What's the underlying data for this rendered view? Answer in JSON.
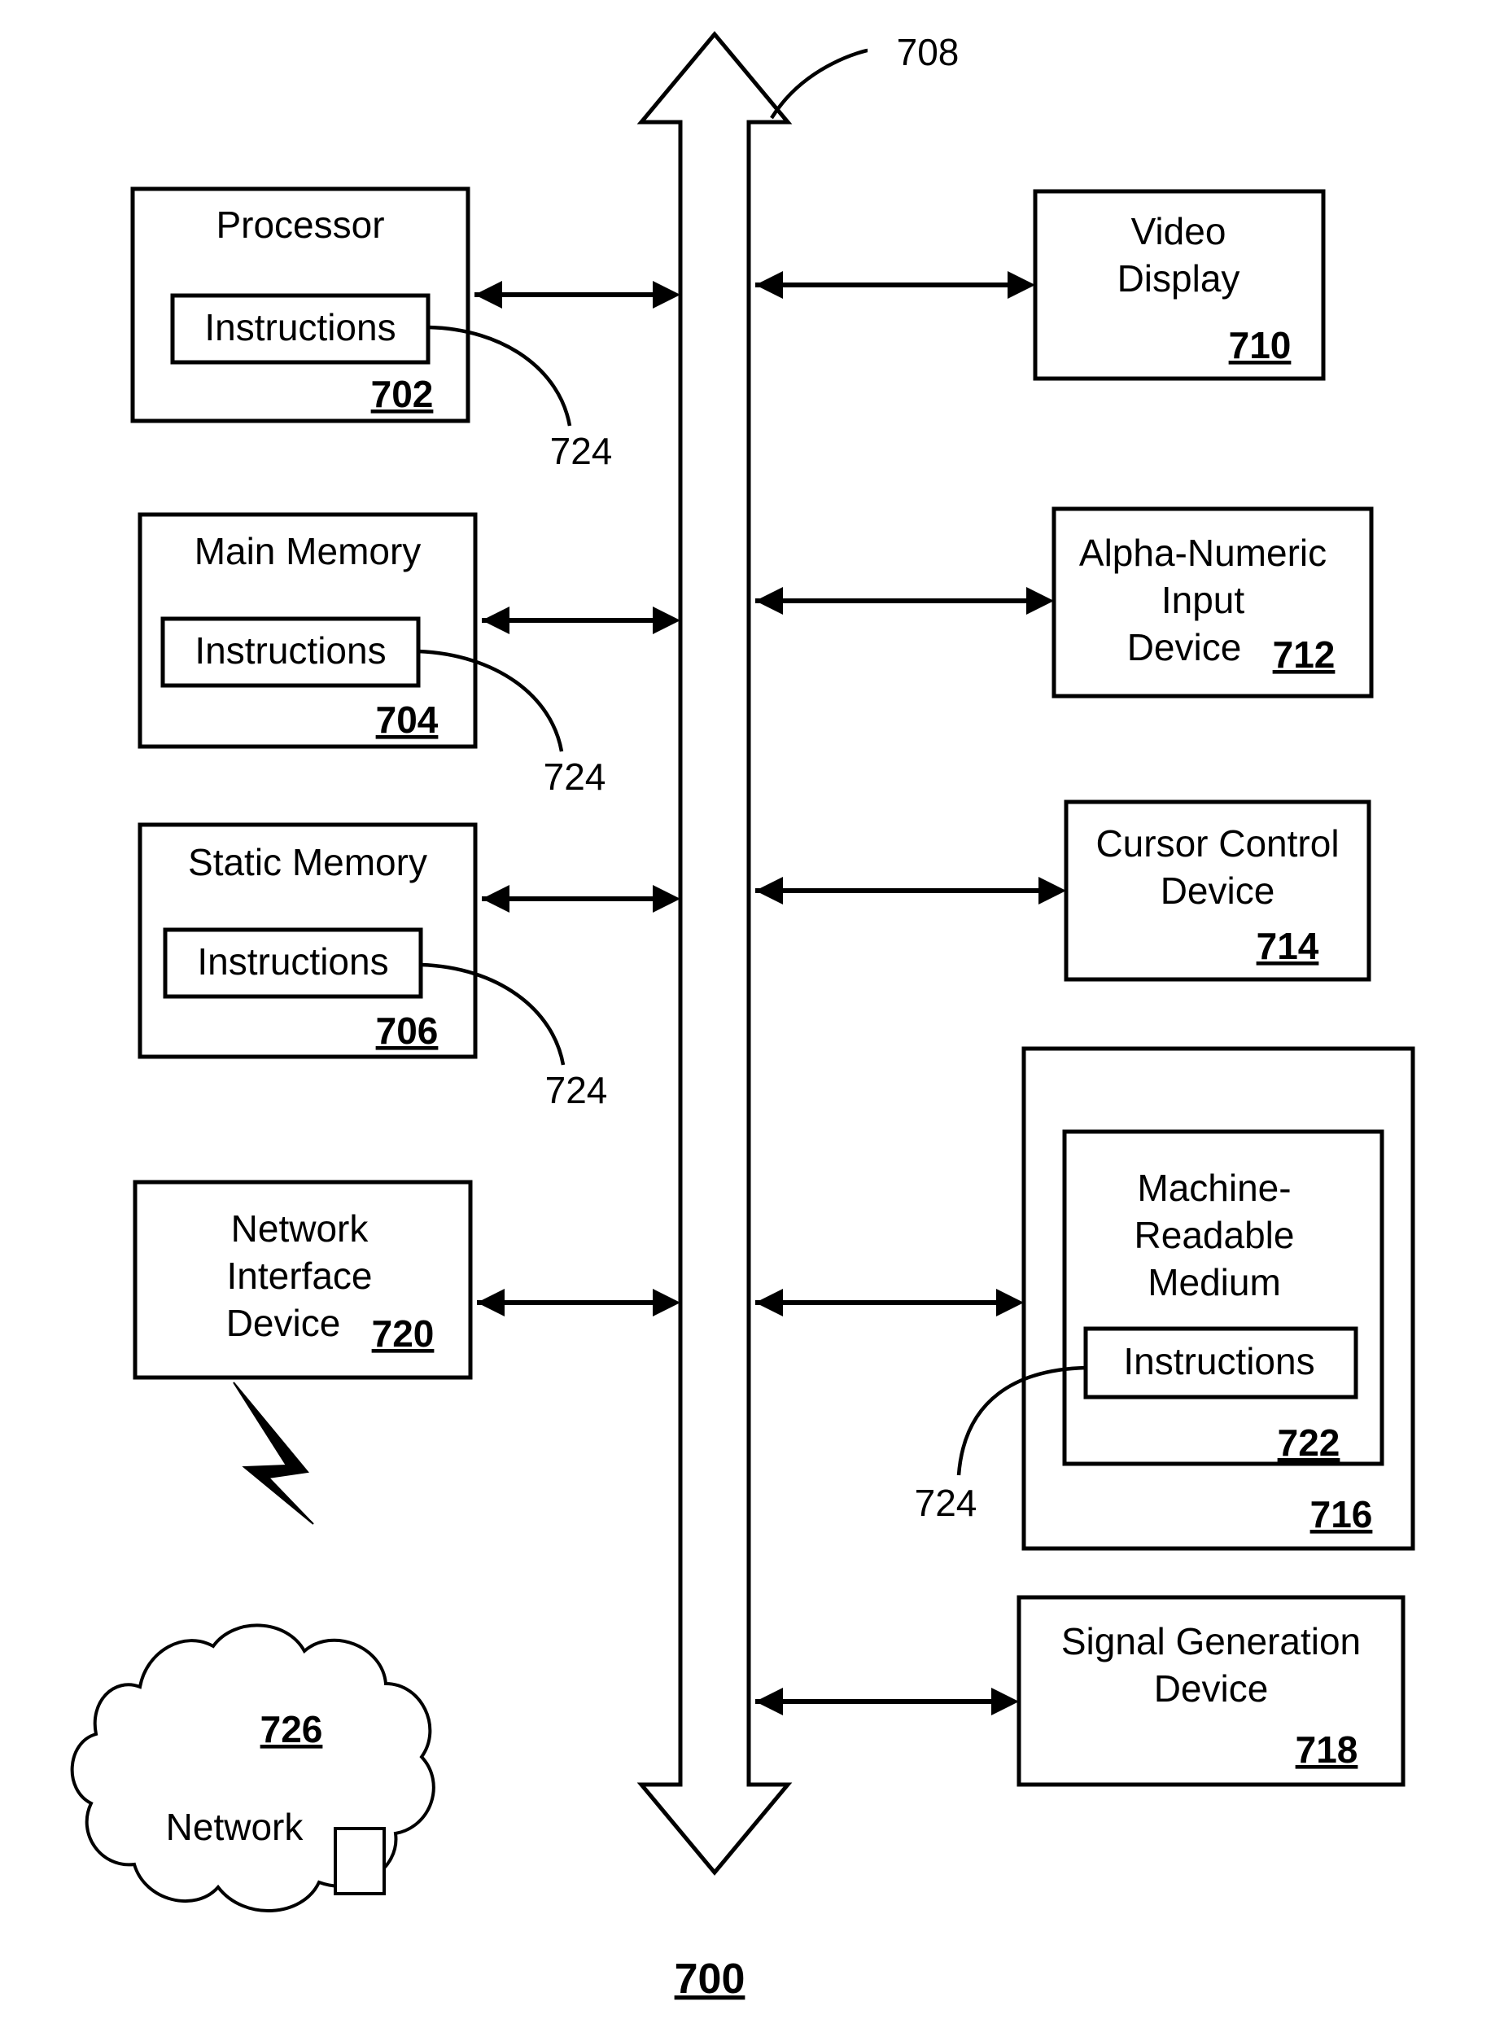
{
  "figure": {
    "number": "700",
    "bus_label": "708",
    "title_ref": "700"
  },
  "left_column": [
    {
      "name": "processor",
      "label": "Processor",
      "ref": "702",
      "inner_label": "Instructions",
      "leader_ref": "724"
    },
    {
      "name": "main-memory",
      "label": "Main Memory",
      "ref": "704",
      "inner_label": "Instructions",
      "leader_ref": "724"
    },
    {
      "name": "static-memory",
      "label": "Static Memory",
      "ref": "706",
      "inner_label": "Instructions",
      "leader_ref": "724"
    },
    {
      "name": "network-interface-device",
      "label_line1": "Network",
      "label_line2": "Interface",
      "label_line3": "Device",
      "ref": "720"
    }
  ],
  "right_column": [
    {
      "name": "video-display",
      "label_line1": "Video",
      "label_line2": "Display",
      "ref": "710"
    },
    {
      "name": "alpha-numeric-input-device",
      "label_line1": "Alpha-Numeric",
      "label_line2": "Input",
      "label_line3": "Device",
      "ref": "712"
    },
    {
      "name": "cursor-control-device",
      "label_line1": "Cursor Control",
      "label_line2": "Device",
      "ref": "714"
    },
    {
      "name": "machine-readable-medium",
      "outer_ref": "716",
      "label_line1": "Machine-",
      "label_line2": "Readable",
      "label_line3": "Medium",
      "inner_label": "Instructions",
      "inner_ref": "722",
      "leader_ref": "724"
    },
    {
      "name": "signal-generation-device",
      "label_line1": "Signal Generation",
      "label_line2": "Device",
      "ref": "718"
    }
  ],
  "network": {
    "label": "Network",
    "ref": "726"
  },
  "colors": {
    "stroke": "#000000",
    "fill": "#ffffff"
  }
}
